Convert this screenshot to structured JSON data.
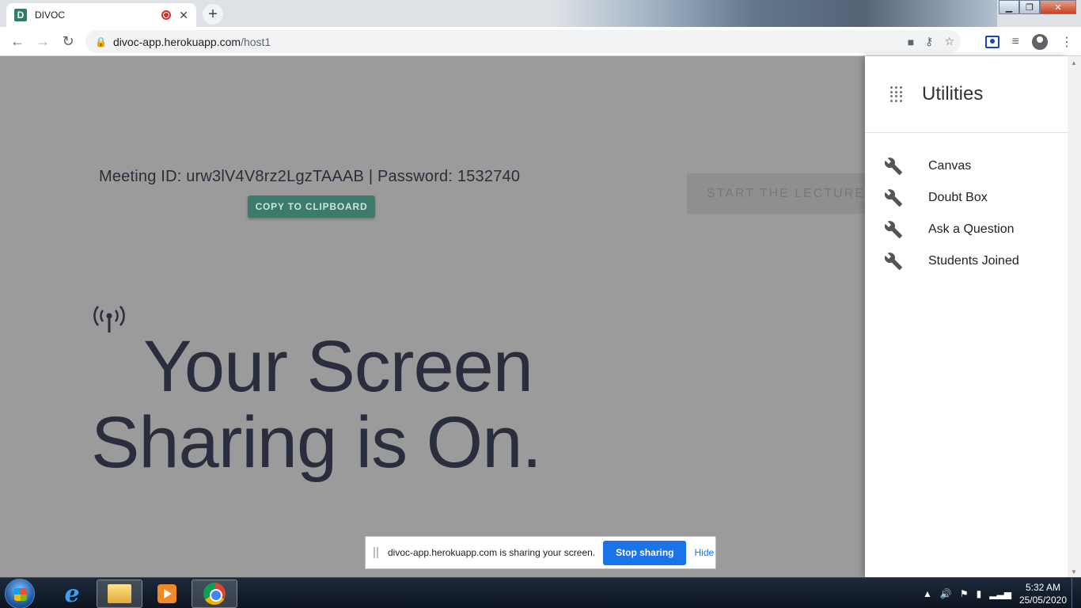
{
  "browser": {
    "tab_title": "DIVOC",
    "tab_favicon_letter": "D",
    "url_host": "divoc-app.herokuapp.com",
    "url_path": "/host1"
  },
  "page": {
    "meeting_info": "Meeting ID: urw3lV4V8rz2LgzTAAAB | Password: 1532740",
    "copy_button": "COPY TO CLIPBOARD",
    "start_button": "START THE LECTURE",
    "hero_line1": "Your Screen",
    "hero_line2": "Sharing is On."
  },
  "drawer": {
    "title": "Utilities",
    "items": [
      {
        "label": "Canvas"
      },
      {
        "label": "Doubt Box"
      },
      {
        "label": "Ask a Question"
      },
      {
        "label": "Students Joined"
      }
    ]
  },
  "share_bar": {
    "message": "divoc-app.herokuapp.com is sharing your screen.",
    "stop_button": "Stop sharing",
    "hide_link": "Hide"
  },
  "taskbar": {
    "time": "5:32 AM",
    "date": "25/05/2020"
  },
  "colors": {
    "accent_green": "#3c7a6c",
    "share_blue": "#1a73e8",
    "overlay_gray": "#9b9b9b"
  }
}
